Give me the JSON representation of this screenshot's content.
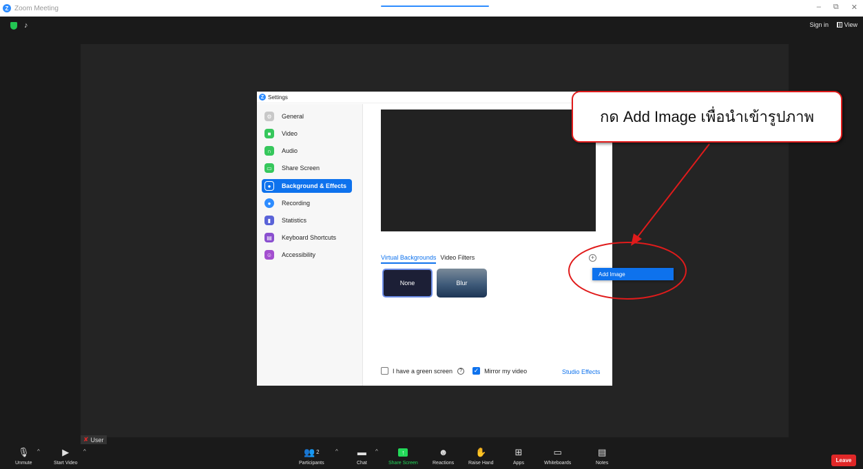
{
  "window": {
    "title": "Zoom Meeting",
    "minimize": "–",
    "restore": "⧉",
    "close": "✕"
  },
  "header": {
    "sign_in": "Sign in",
    "view": "View"
  },
  "participant": {
    "name": "User"
  },
  "settings": {
    "title": "Settings",
    "sidebar": [
      {
        "label": "General",
        "color": "#c8c8c8"
      },
      {
        "label": "Video",
        "color": "#36c75c"
      },
      {
        "label": "Audio",
        "color": "#36c75c"
      },
      {
        "label": "Share Screen",
        "color": "#36c75c"
      },
      {
        "label": "Background & Effects",
        "color": "#0e72ed"
      },
      {
        "label": "Recording",
        "color": "#2d8cff"
      },
      {
        "label": "Statistics",
        "color": "#5a63d8"
      },
      {
        "label": "Keyboard Shortcuts",
        "color": "#8a4fcf"
      },
      {
        "label": "Accessibility",
        "color": "#a34fcf"
      }
    ],
    "tabs": {
      "virtual_backgrounds": "Virtual Backgrounds",
      "video_filters": "Video Filters"
    },
    "backgrounds": {
      "none": "None",
      "blur": "Blur"
    },
    "add_menu_item": "Add Image",
    "green_screen": "I have a green screen",
    "mirror": "Mirror my video",
    "studio_effects": "Studio Effects"
  },
  "annotation": {
    "text": "กด Add Image เพื่อนำเข้ารูปภาพ"
  },
  "toolbar": {
    "unmute": "Unmute",
    "start_video": "Start Video",
    "participants": "Participants",
    "participant_count": "2",
    "chat": "Chat",
    "share_screen": "Share Screen",
    "reactions": "Reactions",
    "raise_hand": "Raise Hand",
    "apps": "Apps",
    "whiteboards": "Whiteboards",
    "notes": "Notes",
    "leave": "Leave"
  }
}
